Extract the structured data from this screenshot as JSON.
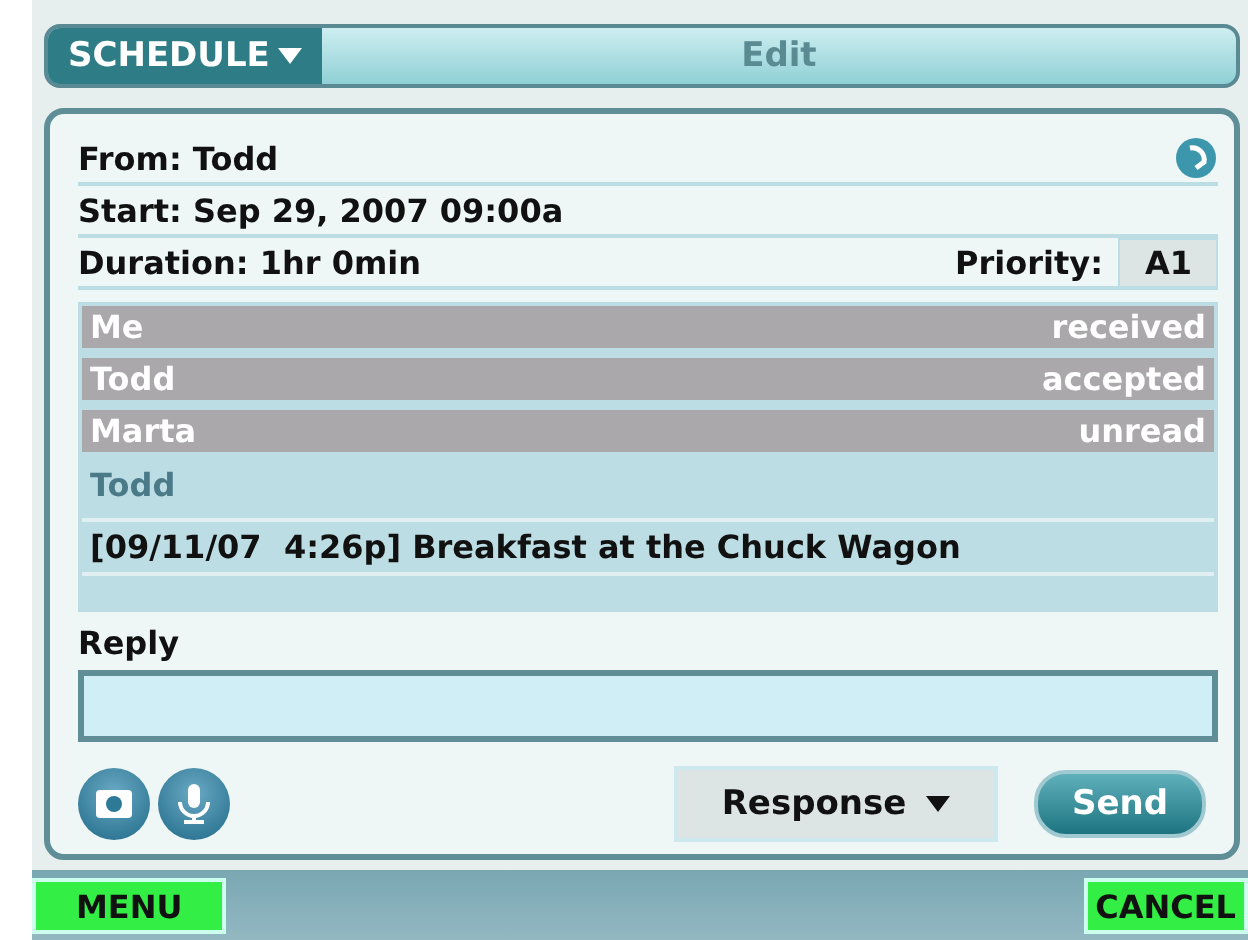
{
  "header": {
    "menu": "SCHEDULE",
    "title": "Edit"
  },
  "details": {
    "from": "From: Todd",
    "start": "Start: Sep 29, 2007 09:00a",
    "duration": "Duration: 1hr 0min",
    "priority_label": "Priority:",
    "priority": "A1"
  },
  "participants": [
    {
      "name": "Me",
      "status": "received"
    },
    {
      "name": "Todd",
      "status": "accepted"
    },
    {
      "name": "Marta",
      "status": "unread"
    }
  ],
  "message": {
    "sender": "Todd",
    "text": "[09/11/07  4:26p] Breakfast at the Chuck Wagon"
  },
  "reply": {
    "label": "Reply"
  },
  "response": "Response",
  "send": "Send",
  "softkeys": {
    "left": "MENU",
    "right": "CANCEL"
  }
}
